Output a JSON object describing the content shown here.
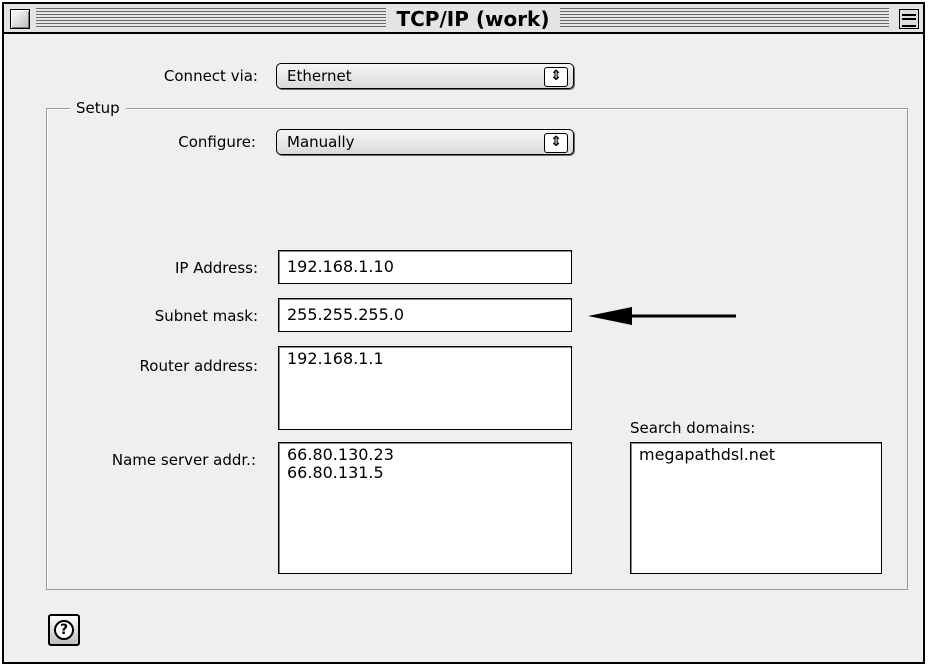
{
  "window": {
    "title": "TCP/IP (work)"
  },
  "connect_via": {
    "label": "Connect via:",
    "value": "Ethernet"
  },
  "setup": {
    "title": "Setup",
    "configure": {
      "label": "Configure:",
      "value": "Manually"
    },
    "ip_address": {
      "label": "IP Address:",
      "value": "192.168.1.10"
    },
    "subnet_mask": {
      "label": "Subnet mask:",
      "value": "255.255.255.0"
    },
    "router_address": {
      "label": "Router address:",
      "value": "192.168.1.1"
    },
    "name_server": {
      "label": "Name server addr.:",
      "value": "66.80.130.23\n66.80.131.5"
    },
    "search_domains": {
      "label": "Search domains:",
      "value": "megapathdsl.net"
    }
  },
  "help": {
    "icon": "question-icon"
  },
  "annotation": {
    "pointer": "arrow-left-icon"
  }
}
